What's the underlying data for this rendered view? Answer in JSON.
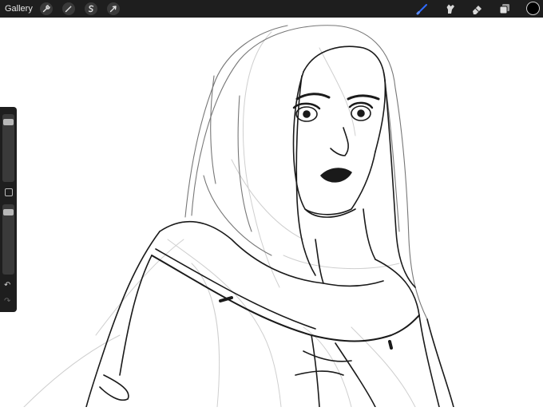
{
  "toolbar": {
    "gallery_label": "Gallery",
    "left_tools": [
      "wrench-icon",
      "magic-wand-icon",
      "selection-icon",
      "transform-icon"
    ],
    "right_tools": [
      "brush-icon",
      "smudge-icon",
      "eraser-icon",
      "layers-icon"
    ],
    "active_tool": "brush-icon",
    "accent_color": "#2f6bff",
    "current_color": "#000000"
  },
  "sidebar": {
    "brush_size": 0.08,
    "brush_opacity": 0.08,
    "modify_button": "square-icon",
    "undo_icon": "undo-icon",
    "redo_icon": "redo-icon"
  },
  "canvas": {
    "subject": "sketch-of-woman"
  }
}
